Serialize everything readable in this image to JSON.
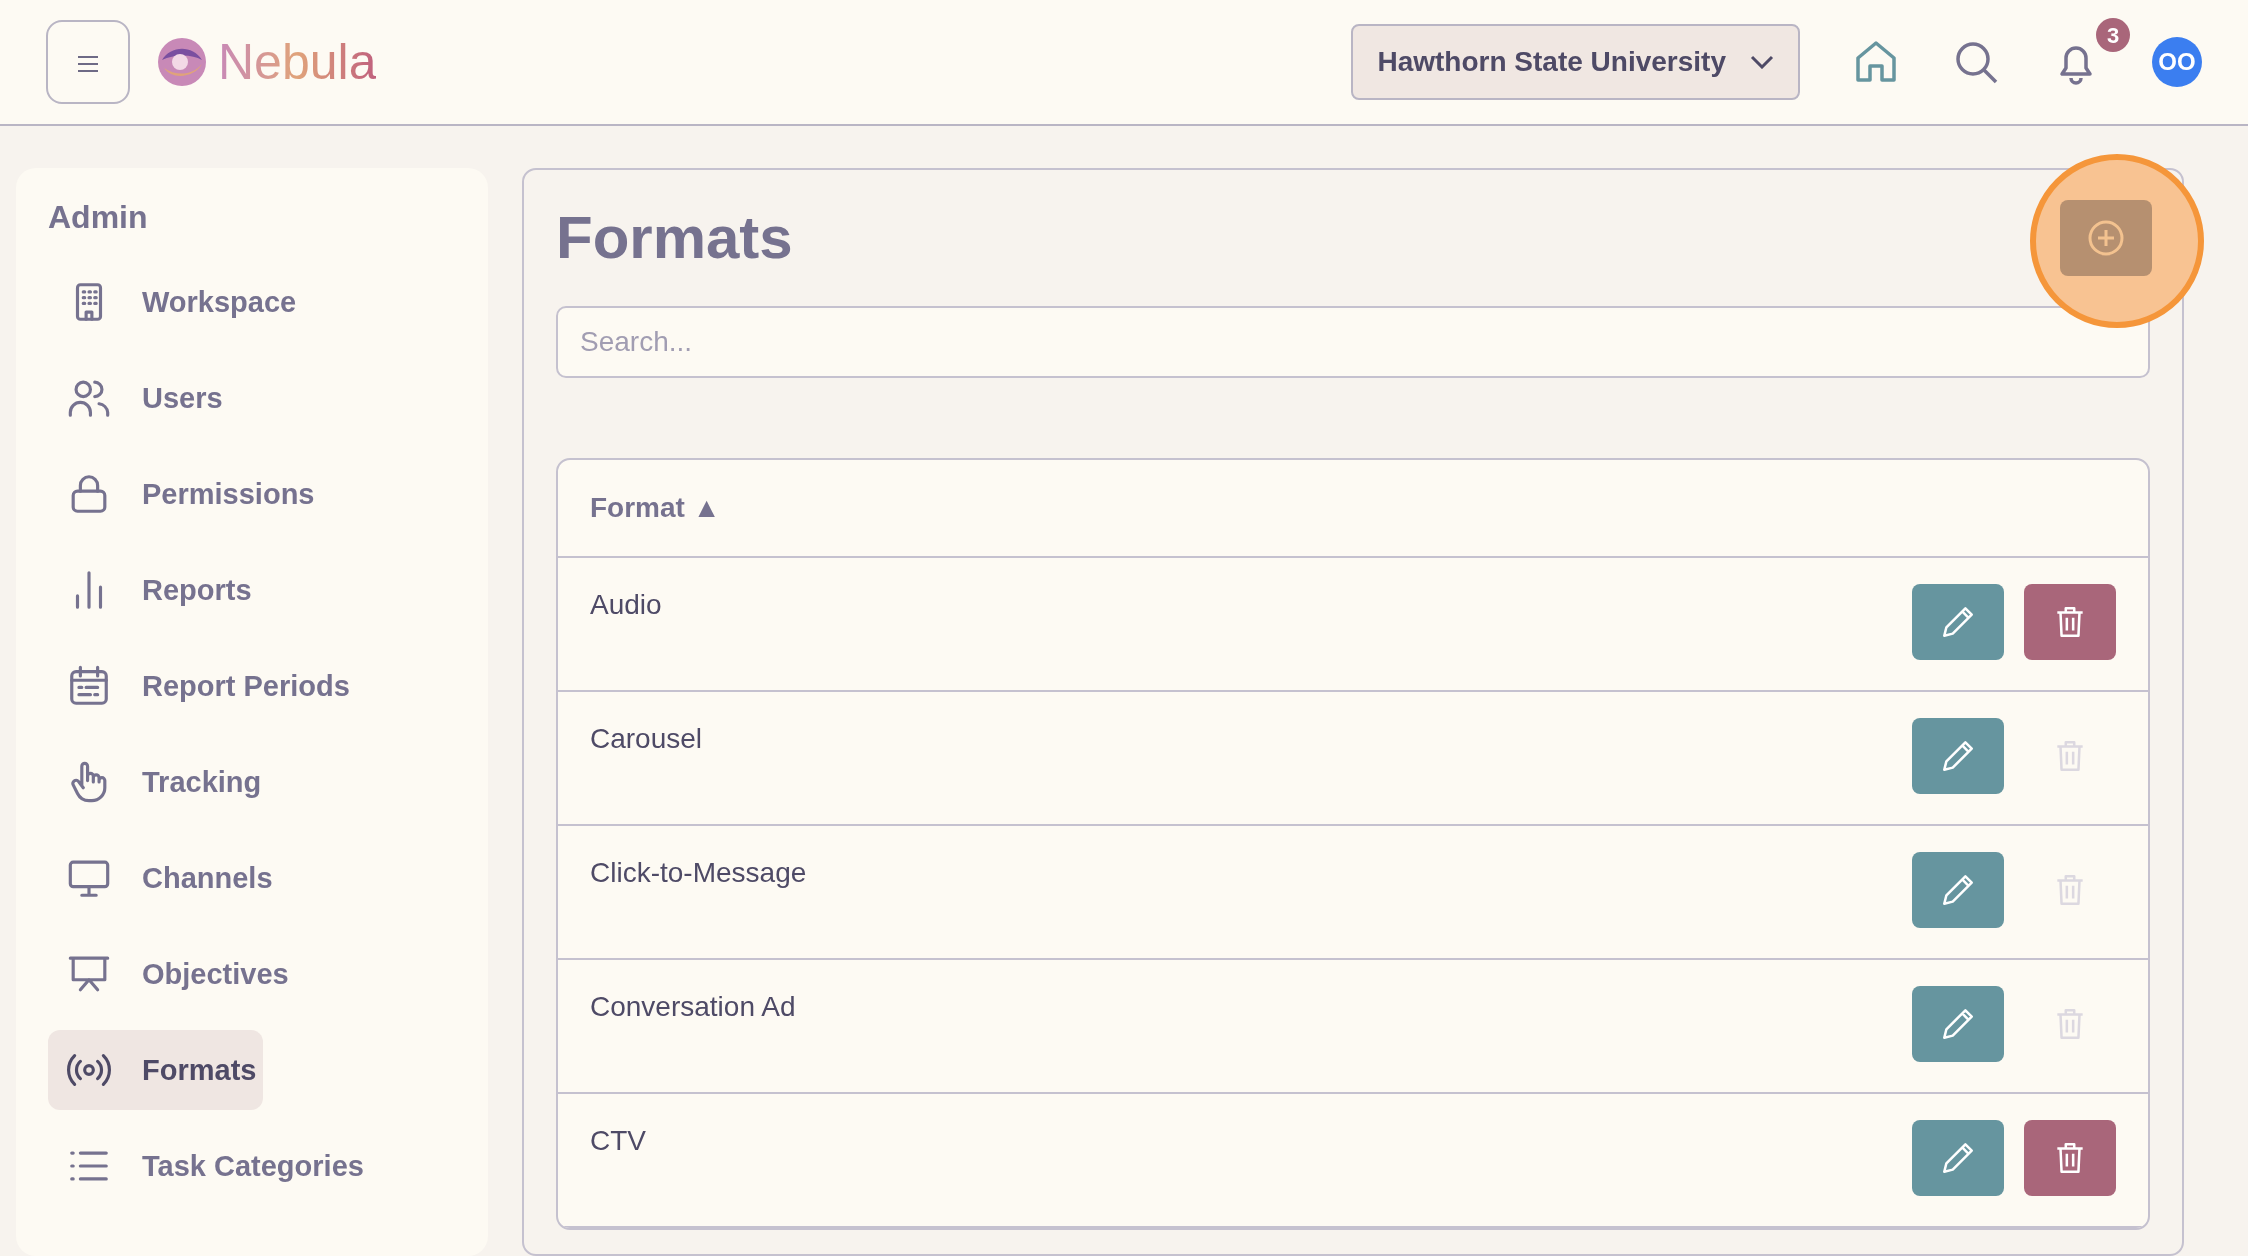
{
  "header": {
    "logo_text": "Nebula",
    "workspace_select": "Hawthorn State University",
    "notifications_count": "3",
    "avatar_initials": "OO"
  },
  "sidebar": {
    "heading": "Admin",
    "items": [
      {
        "label": "Workspace",
        "selected": false
      },
      {
        "label": "Users",
        "selected": false
      },
      {
        "label": "Permissions",
        "selected": false
      },
      {
        "label": "Reports",
        "selected": false
      },
      {
        "label": "Report Periods",
        "selected": false
      },
      {
        "label": "Tracking",
        "selected": false
      },
      {
        "label": "Channels",
        "selected": false
      },
      {
        "label": "Objectives",
        "selected": false
      },
      {
        "label": "Formats",
        "selected": true
      },
      {
        "label": "Task Categories",
        "selected": false
      }
    ]
  },
  "main": {
    "title": "Formats",
    "add_button_highlighted": true,
    "search": {
      "placeholder": "Search..."
    },
    "table": {
      "column": "Format ▲",
      "rows": [
        {
          "name": "Audio",
          "deletable": true
        },
        {
          "name": "Carousel",
          "deletable": false
        },
        {
          "name": "Click-to-Message",
          "deletable": false
        },
        {
          "name": "Conversation Ad",
          "deletable": false
        },
        {
          "name": "CTV",
          "deletable": true
        }
      ]
    }
  }
}
